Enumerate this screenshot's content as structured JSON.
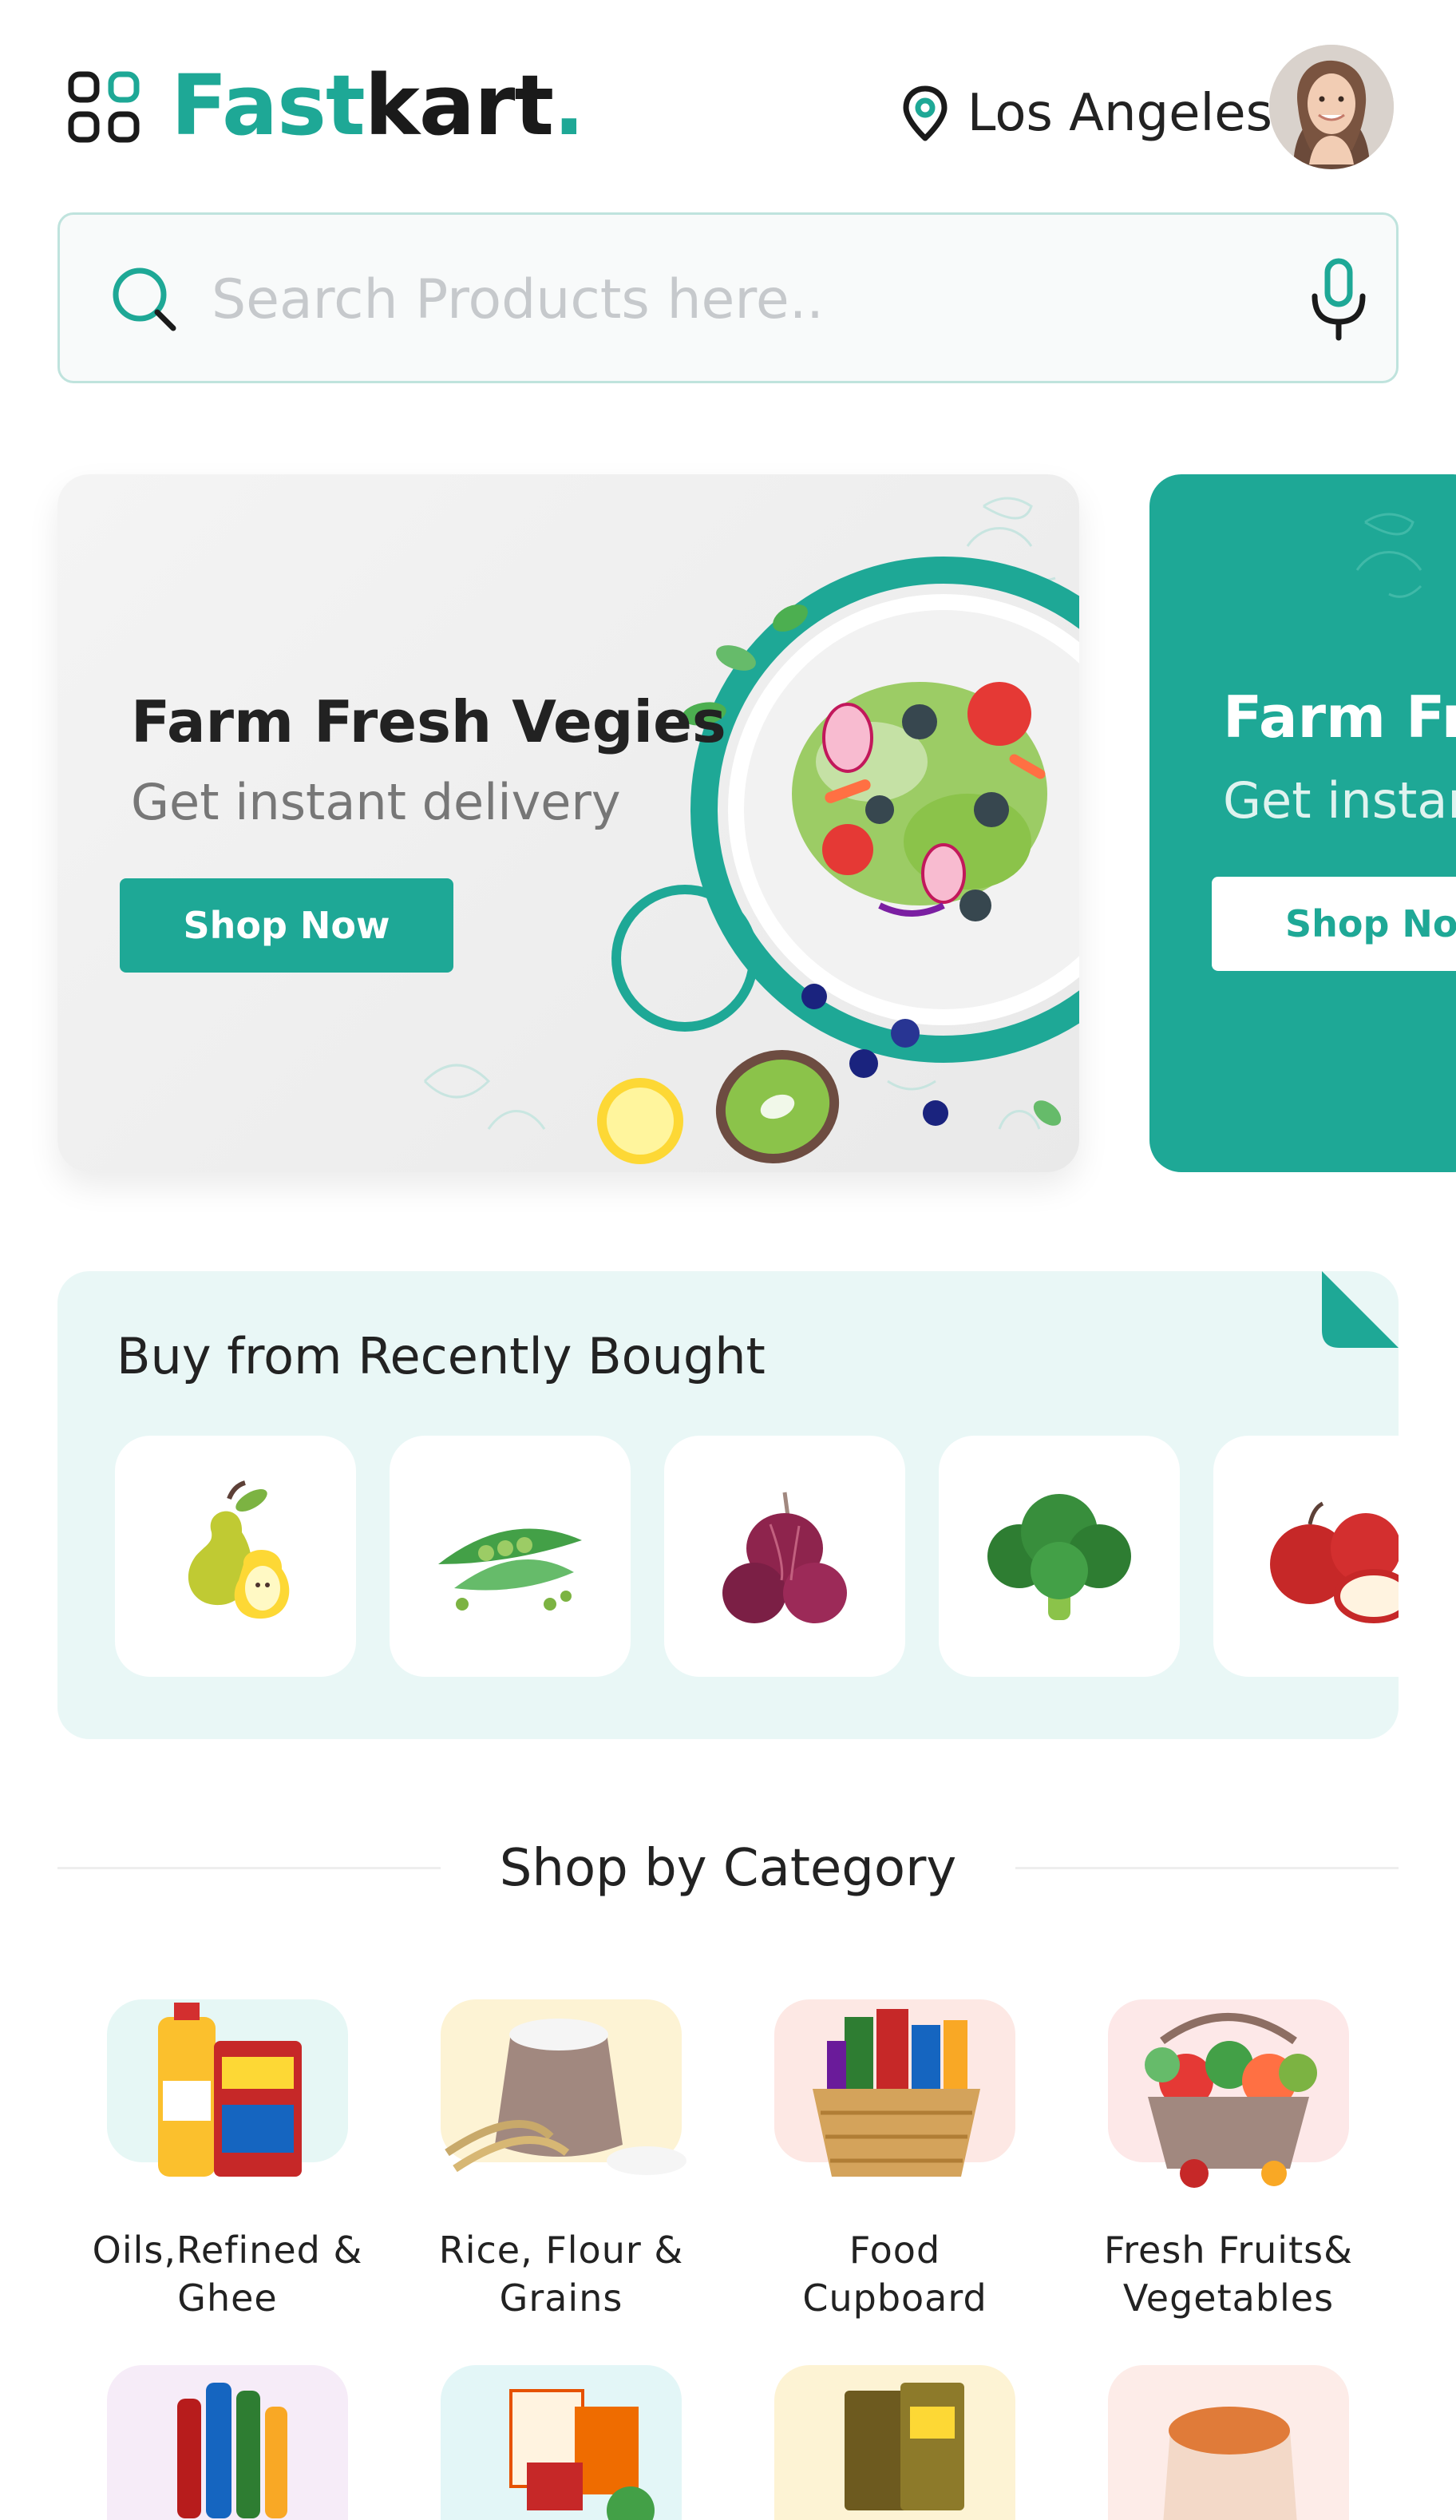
{
  "header": {
    "logo_part1": "Fast",
    "logo_part2": "kart",
    "logo_dot": ".",
    "location": "Los Angeles",
    "icons": {
      "menu": "grid-menu-icon",
      "location": "location-pin-icon"
    }
  },
  "search": {
    "placeholder": "Search Products here..",
    "value": "",
    "icons": {
      "search": "search-icon",
      "voice": "mic-icon"
    }
  },
  "banners": [
    {
      "title": "Farm Fresh Vegies",
      "subtitle": "Get instant delivery",
      "button": "Shop Now"
    },
    {
      "title": "Farm Fr",
      "subtitle": "Get instar",
      "button": "Shop Nov"
    }
  ],
  "recent": {
    "title": "Buy from Recently Bought",
    "items": [
      "pear",
      "green-peas",
      "red-onion",
      "broccoli",
      "red-apple"
    ]
  },
  "categories": {
    "title": "Shop by Category",
    "items": [
      {
        "line1": "Oils,Refined &",
        "line2": "Ghee",
        "tile_color": "#e6f7f5",
        "icon": "oil-bottles-icon"
      },
      {
        "line1": "Rice, Flour &",
        "line2": "Grains",
        "tile_color": "#fdf3d4",
        "icon": "flour-sack-icon"
      },
      {
        "line1": "Food",
        "line2": "Cupboard",
        "tile_color": "#fde8e4",
        "icon": "food-basket-icon"
      },
      {
        "line1": "Fresh Fruits&",
        "line2": "Vegetables",
        "tile_color": "#fde8e8",
        "icon": "veg-basket-icon"
      },
      {
        "line1": "",
        "line2": "",
        "tile_color": "#f6ecf8",
        "icon": "soft-drinks-icon"
      },
      {
        "line1": "",
        "line2": "",
        "tile_color": "#e3f6f7",
        "icon": "packaged-food-icon"
      },
      {
        "line1": "",
        "line2": "",
        "tile_color": "#fdf3d4",
        "icon": "snack-packs-icon"
      },
      {
        "line1": "",
        "line2": "",
        "tile_color": "#fdece8",
        "icon": "pulses-sack-icon"
      }
    ]
  },
  "colors": {
    "brand": "#1ea896",
    "recent_bg": "#e9f7f6",
    "text": "#222222",
    "muted": "#777777"
  }
}
